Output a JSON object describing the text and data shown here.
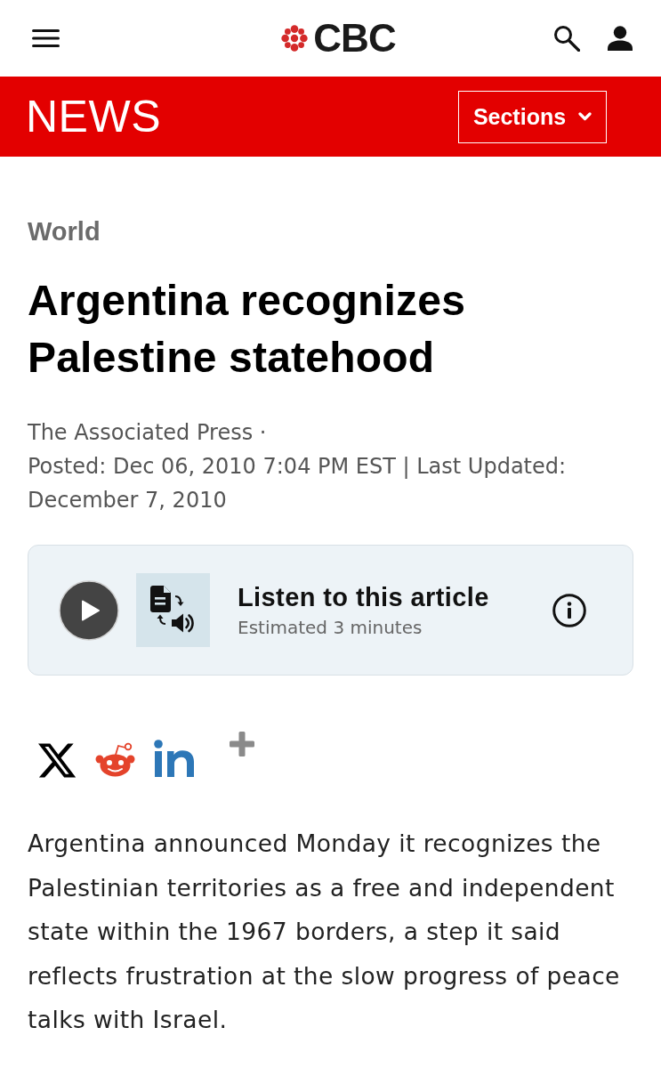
{
  "header": {
    "logo_text": "CBC"
  },
  "news_bar": {
    "title": "NEWS",
    "sections_button": "Sections"
  },
  "article": {
    "category": "World",
    "headline": "Argentina recognizes Palestine statehood",
    "byline": "The Associated Press ·",
    "posted": "Posted: Dec 06, 2010 7:04 PM EST | Last Updated: December 7, 2010"
  },
  "listen": {
    "title": "Listen to this article",
    "duration": "Estimated 3 minutes"
  },
  "share": [
    {
      "kind": "x"
    },
    {
      "kind": "reddit"
    },
    {
      "kind": "linkedin"
    },
    {
      "kind": "more"
    }
  ],
  "body": {
    "paragraphs": [
      "Argentina announced Monday it recognizes the Palestinian territories as a free and independent state within the 1967 borders, a step it said reflects frustration at the slow progress of peace talks with Israel."
    ]
  }
}
